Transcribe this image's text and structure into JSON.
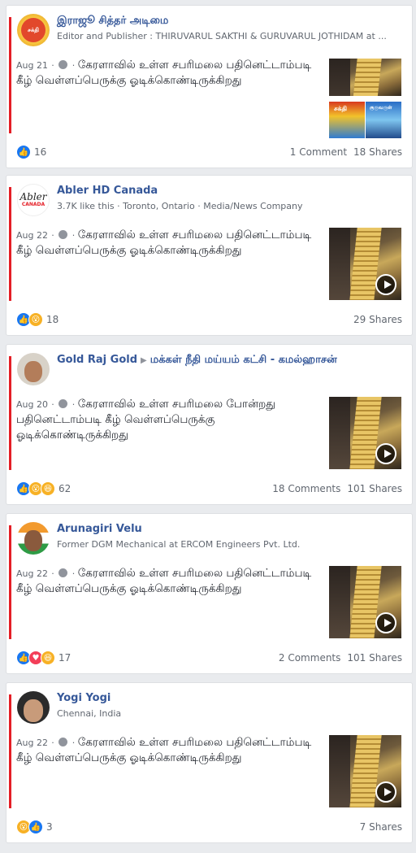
{
  "posts": [
    {
      "name": "இராஜூ சித்தர் அடிமை",
      "target": "",
      "subtitle": "Editor and Publisher : THIRUVARUL SAKTHI & GURUVARUL JOTHIDAM at ...",
      "date": "Aug 21",
      "text": "கேரளாவில் உள்ள சபரிமலை பதினெட்டாம்படி கீழ் வெள்ளப்பெருக்கு ஓடிக்கொண்டிருக்கிறது",
      "reaction_count": "16",
      "comments": "1 Comment",
      "shares": "18 Shares",
      "reactions": [
        "like"
      ],
      "avatar_text": "சக்தி",
      "thumb_labels": [
        "சக்தி",
        "குருவருள்"
      ]
    },
    {
      "name": "Abler HD Canada",
      "target": "",
      "subtitle": "3.7K like this · Toronto, Ontario · Media/News Company",
      "date": "Aug 22",
      "text": "கேரளாவில் உள்ள சபரிமலை பதினெட்டாம்படி கீழ் வெள்ளப்பெருக்கு ஓடிக்கொண்டிருக்கிறது",
      "reaction_count": "18",
      "comments": "",
      "shares": "29 Shares",
      "reactions": [
        "like",
        "wow"
      ],
      "avatar_text": "Abler",
      "avatar_subtext": "CANADA"
    },
    {
      "name": "Gold Raj Gold",
      "target": "மக்கள் நீதி மய்யம் கட்சி - கமல்ஹாசன்",
      "subtitle": "",
      "date": "Aug 20",
      "text": "கேரளாவில் உள்ள சபரிமலை போன்றது பதினெட்டாம்படி கீழ் வெள்ளப்பெருக்கு ஓடிக்கொண்டிருக்கிறது",
      "reaction_count": "62",
      "comments": "18 Comments",
      "shares": "101 Shares",
      "reactions": [
        "like",
        "wow",
        "haha"
      ]
    },
    {
      "name": "Arunagiri Velu",
      "target": "",
      "subtitle": "Former DGM Mechanical at ERCOM Engineers Pvt. Ltd.",
      "date": "Aug 22",
      "text": "கேரளாவில் உள்ள சபரிமலை பதினெட்டாம்படி கீழ் வெள்ளப்பெருக்கு ஓடிக்கொண்டிருக்கிறது",
      "reaction_count": "17",
      "comments": "2 Comments",
      "shares": "101 Shares",
      "reactions": [
        "like",
        "love",
        "haha"
      ]
    },
    {
      "name": "Yogi Yogi",
      "target": "",
      "subtitle": "Chennai, India",
      "date": "Aug 22",
      "text": "கேரளாவில் உள்ள சபரிமலை பதினெட்டாம்படி கீழ் வெள்ளப்பெருக்கு ஓடிக்கொண்டிருக்கிறது",
      "reaction_count": "3",
      "comments": "",
      "shares": "7 Shares",
      "reactions": [
        "wow",
        "like"
      ]
    }
  ],
  "colors": {
    "name": "#365899",
    "accent_bar": "#e41e26",
    "like": "#1877f2",
    "wow": "#f7b125",
    "love": "#f33e58"
  }
}
